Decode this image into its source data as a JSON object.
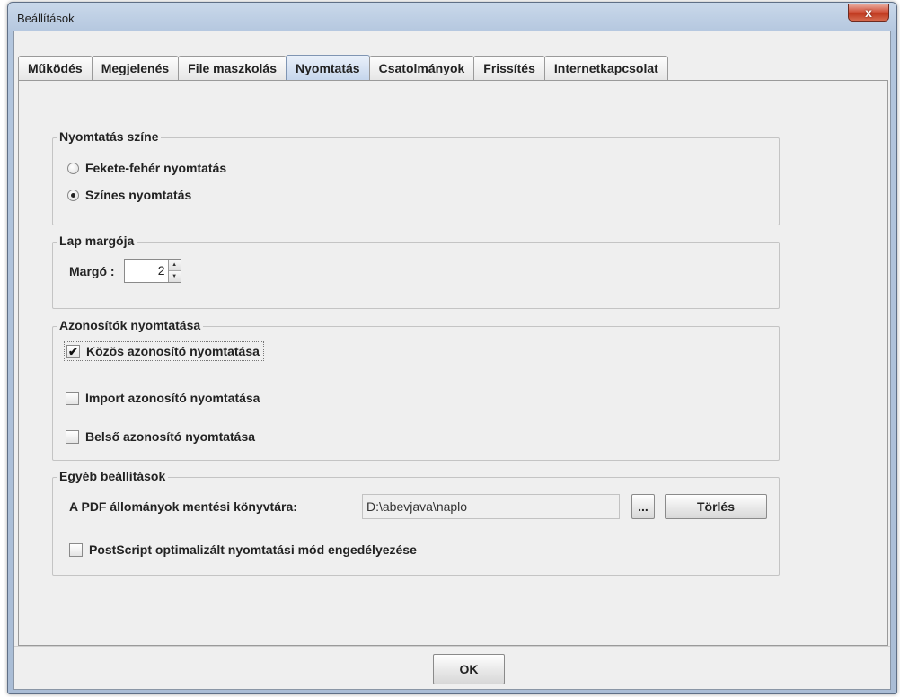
{
  "window": {
    "title": "Beállítások",
    "close_symbol": "x"
  },
  "tabs": [
    {
      "label": "Működés",
      "active": false
    },
    {
      "label": "Megjelenés",
      "active": false
    },
    {
      "label": "File maszkolás",
      "active": false
    },
    {
      "label": "Nyomtatás",
      "active": true
    },
    {
      "label": "Csatolmányok",
      "active": false
    },
    {
      "label": "Frissítés",
      "active": false
    },
    {
      "label": "Internetkapcsolat",
      "active": false
    }
  ],
  "print_color": {
    "title": "Nyomtatás színe",
    "options": [
      {
        "label": "Fekete-fehér nyomtatás",
        "selected": false
      },
      {
        "label": "Színes nyomtatás",
        "selected": true
      }
    ]
  },
  "margin": {
    "title": "Lap margója",
    "label": "Margó :",
    "value": "2",
    "up_symbol": "▲",
    "down_symbol": "▼"
  },
  "identifiers": {
    "title": "Azonosítók nyomtatása",
    "items": [
      {
        "label": "Közös azonosító nyomtatása",
        "checked": true
      },
      {
        "label": "Import azonosító nyomtatása",
        "checked": false
      },
      {
        "label": "Belső azonosító nyomtatása",
        "checked": false
      }
    ],
    "check_symbol": "✔"
  },
  "other": {
    "title": "Egyéb beállítások",
    "pdf_dir_label": "A PDF állományok mentési könyvtára:",
    "pdf_dir_value": "D:\\abevjava\\naplo",
    "browse_label": "...",
    "clear_label": "Törlés",
    "postscript_label": "PostScript optimalizált nyomtatási mód engedélyezése",
    "postscript_checked": false
  },
  "footer": {
    "ok_label": "OK"
  }
}
